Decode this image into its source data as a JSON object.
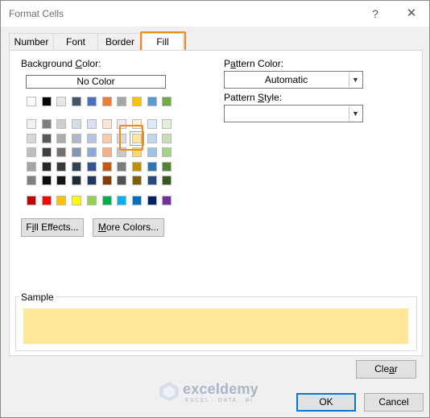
{
  "window": {
    "title": "Format Cells",
    "help_glyph": "?",
    "close_glyph": "✕"
  },
  "tabs": [
    {
      "label": "Number",
      "active": false
    },
    {
      "label": "Font",
      "active": false
    },
    {
      "label": "Border",
      "active": false
    },
    {
      "label": "Fill",
      "active": true
    }
  ],
  "fill": {
    "background_color_label_pre": "Background ",
    "background_color_label_ul": "C",
    "background_color_label_post": "olor:",
    "no_color_label": "No Color",
    "pattern_color_label_pre": "P",
    "pattern_color_label_ul": "a",
    "pattern_color_label_post": "ttern Color:",
    "pattern_color_value": "Automatic",
    "pattern_style_label_pre": "Pattern ",
    "pattern_style_label_ul": "S",
    "pattern_style_label_post": "tyle:",
    "pattern_style_value": "",
    "fill_effects_pre": "F",
    "fill_effects_ul": "i",
    "fill_effects_post": "ll Effects...",
    "more_colors_pre": "",
    "more_colors_ul": "M",
    "more_colors_post": "ore Colors...",
    "selected_color": "#ffe699",
    "theme_top_row": [
      "#ffffff",
      "#000000",
      "#e7e6e6",
      "#44546a",
      "#4472c4",
      "#ed7d31",
      "#a5a5a5",
      "#ffc000",
      "#5b9bd5",
      "#70ad47"
    ],
    "theme_shades": [
      [
        "#f2f2f2",
        "#7f7f7f",
        "#d0cece",
        "#d6dce4",
        "#d9e2f3",
        "#fbe5d5",
        "#ededed",
        "#fff2cc",
        "#deebf6",
        "#e2efd9"
      ],
      [
        "#d8d8d8",
        "#595959",
        "#aeabab",
        "#adb9ca",
        "#b4c6e7",
        "#f7cbac",
        "#dbdbdb",
        "#ffe599",
        "#bdd7ee",
        "#c5e0b3"
      ],
      [
        "#bfbfbf",
        "#3f3f3f",
        "#757070",
        "#8496b0",
        "#8eaadb",
        "#f4b183",
        "#c9c9c9",
        "#ffd965",
        "#9cc3e5",
        "#a8d08d"
      ],
      [
        "#a5a5a5",
        "#262626",
        "#3a3838",
        "#323f4f",
        "#2f5496",
        "#c55a11",
        "#7b7b7b",
        "#bf9000",
        "#2e75b5",
        "#538135"
      ],
      [
        "#7f7f7f",
        "#0c0c0c",
        "#171616",
        "#222a35",
        "#1f3864",
        "#833c0b",
        "#525252",
        "#7f6000",
        "#1e4e79",
        "#375623"
      ]
    ],
    "standard_colors": [
      "#c00000",
      "#ff0000",
      "#ffc000",
      "#ffff00",
      "#92d050",
      "#00b050",
      "#00b0f0",
      "#0070c0",
      "#002060",
      "#7030a0"
    ]
  },
  "sample": {
    "label": "Sample"
  },
  "buttons": {
    "clear_pre": "Cle",
    "clear_ul": "a",
    "clear_post": "r",
    "ok": "OK",
    "cancel": "Cancel"
  },
  "watermark": {
    "name": "exceldemy",
    "tagline": "EXCEL · DATA · BI"
  }
}
